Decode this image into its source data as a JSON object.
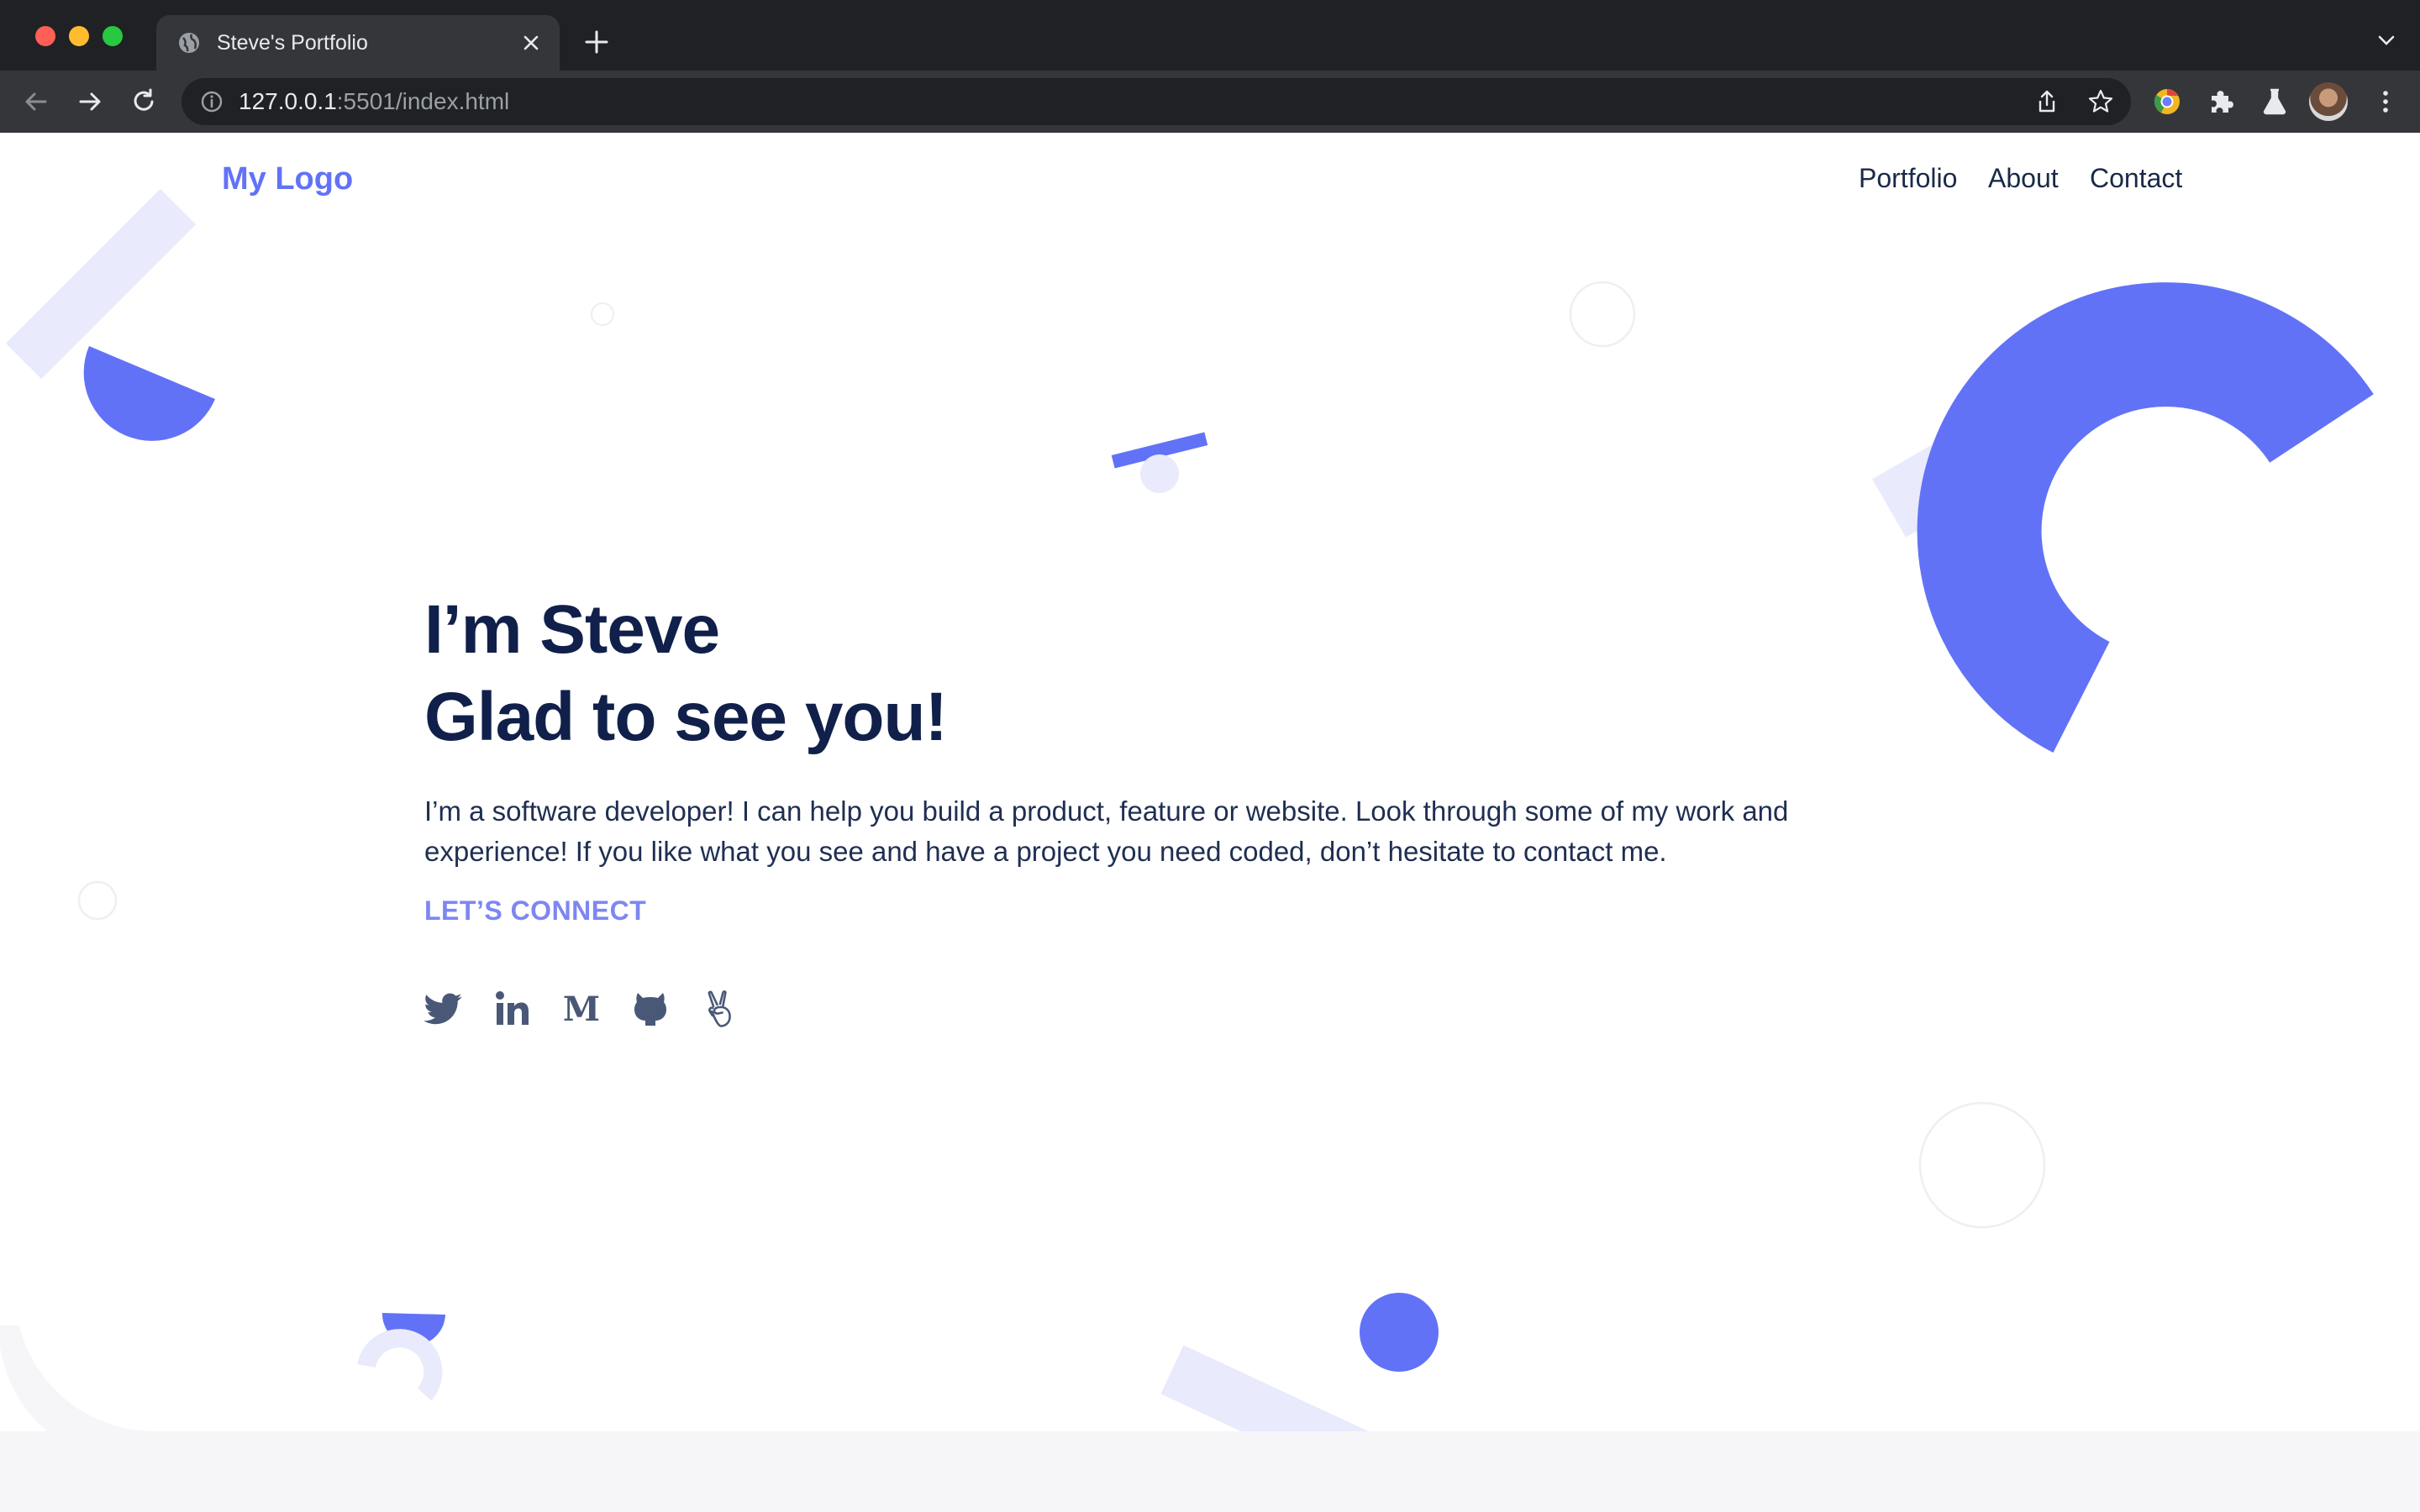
{
  "browser": {
    "tab": {
      "title": "Steve's Portfolio",
      "favicon": "globe-icon"
    },
    "address_bar": {
      "host": "127.0.0.1",
      "rest": ":5501/index.html"
    },
    "icons": [
      "back-arrow-icon",
      "forward-arrow-icon",
      "reload-icon",
      "info-icon",
      "share-icon",
      "star-icon",
      "chrome-extension-icon",
      "puzzle-icon",
      "labs-flask-icon",
      "kebab-menu-icon"
    ]
  },
  "page": {
    "logo": "My Logo",
    "nav": {
      "portfolio": "Portfolio",
      "about": "About",
      "contact": "Contact"
    },
    "hero": {
      "line1": "I’m Steve",
      "line2": "Glad to see you!",
      "intro": "I’m a software developer! I can help you build a product, feature or website. Look through some of my work and experience! If you like what you see and have a project you need coded, don’t hesitate to contact me.",
      "connect": "LET’S CONNECT"
    },
    "socials": [
      "twitter-icon",
      "linkedin-icon",
      "medium-icon",
      "github-icon",
      "angellist-icon"
    ]
  },
  "colors": {
    "accent": "#6272f7",
    "accent_light": "#e9eafc",
    "heading": "#10204a",
    "body_text": "#1f2f52",
    "connect": "#7d86f2",
    "social_icons": "#4a5878",
    "footer": "#f6f6f9"
  }
}
